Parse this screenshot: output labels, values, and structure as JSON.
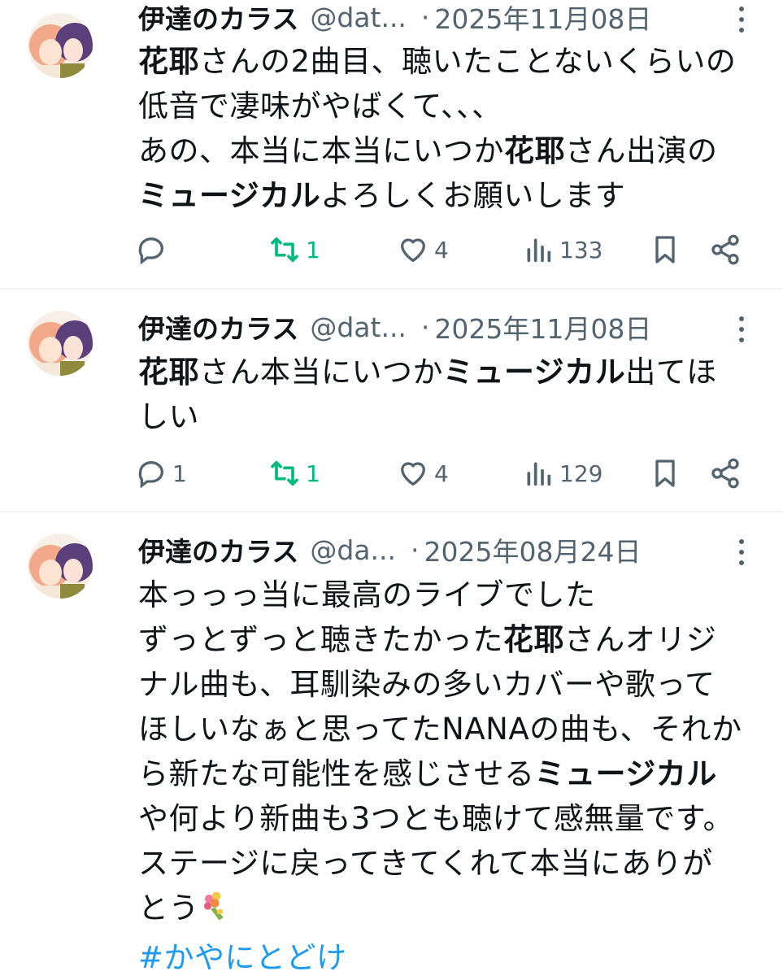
{
  "tweets": [
    {
      "author_name": "伊達のカラス",
      "handle": "@dat...",
      "separator": "·",
      "date": "2025年11月08日",
      "lines": [
        [
          {
            "t": "花耶",
            "b": true
          },
          {
            "t": "さんの2曲目、聴いたことないくらいの"
          }
        ],
        [
          {
            "t": "低音で凄味がやばくて、、、"
          }
        ],
        [
          {
            "t": "あの、本当に本当にいつか"
          },
          {
            "t": "花耶",
            "b": true
          },
          {
            "t": "さん出演の"
          }
        ],
        [
          {
            "t": "ミュージカル",
            "b": true
          },
          {
            "t": "よろしくお願いします"
          }
        ]
      ],
      "stats": {
        "replies": "",
        "retweets": "1",
        "likes": "4",
        "views": "133"
      }
    },
    {
      "author_name": "伊達のカラス",
      "handle": "@dat...",
      "separator": "·",
      "date": "2025年11月08日",
      "lines": [
        [
          {
            "t": "花耶",
            "b": true
          },
          {
            "t": "さん本当にいつか"
          },
          {
            "t": "ミュージカル",
            "b": true
          },
          {
            "t": "出てほ"
          }
        ],
        [
          {
            "t": "しい"
          }
        ]
      ],
      "stats": {
        "replies": "1",
        "retweets": "1",
        "likes": "4",
        "views": "129"
      }
    },
    {
      "author_name": "伊達のカラス",
      "handle": "@da...",
      "separator": "·",
      "date": "2025年08月24日",
      "lines": [
        [
          {
            "t": "本っっっ当に最高のライブでした"
          }
        ],
        [
          {
            "t": "ずっとずっと聴きたかった"
          },
          {
            "t": "花耶",
            "b": true
          },
          {
            "t": "さんオリジ"
          }
        ],
        [
          {
            "t": "ナル曲も、耳馴染みの多いカバーや歌って"
          }
        ],
        [
          {
            "t": "ほしいなぁと思ってたNANAの曲も、それか"
          }
        ],
        [
          {
            "t": "ら新たな可能性を感じさせる"
          },
          {
            "t": "ミュージカル",
            "b": true
          }
        ],
        [
          {
            "t": "や何より新曲も3つとも聴けて感無量です。"
          }
        ],
        [
          {
            "t": "ステージに戻ってきてくれて本当にありが"
          }
        ],
        [
          {
            "t": "とう"
          },
          {
            "emoji": "bouquet"
          }
        ],
        [
          {
            "t": "#かやにとどけ",
            "link": true
          }
        ]
      ],
      "stats": null
    }
  ],
  "colors": {
    "text": "#0f1419",
    "secondary": "#536471",
    "retweet": "#00ba7c",
    "link": "#1d9bf0",
    "divider": "#eff3f4"
  },
  "icons": [
    "reply-icon",
    "retweet-icon",
    "like-icon",
    "views-icon",
    "bookmark-icon",
    "share-icon",
    "more-icon",
    "avatar"
  ]
}
